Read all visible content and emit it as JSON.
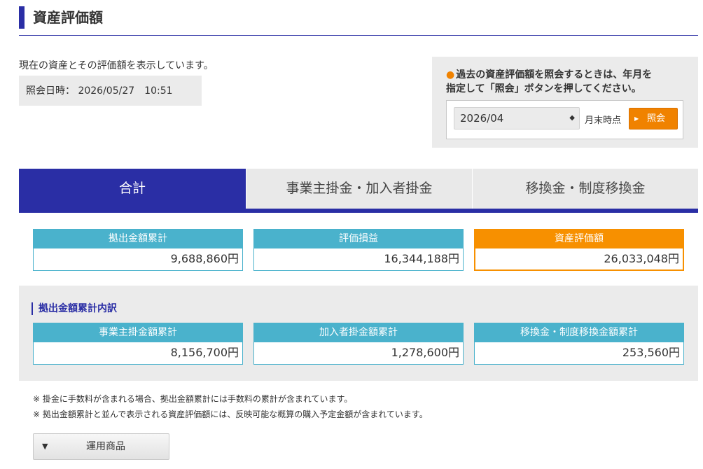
{
  "header": {
    "title": "資産評価額"
  },
  "intro": {
    "description": "現在の資産とその評価額を表示しています。",
    "datetime_label": "照会日時：",
    "date": "2026/05/27",
    "time": "10:51"
  },
  "query": {
    "note_line1": "過去の資産評価額を照会するときは、年月を",
    "note_line2": "指定して「照会」ボタンを押してください。",
    "selected_month": "2026/04",
    "suffix": "月末時点",
    "button_label": "照会",
    "accent_color": "#f08200"
  },
  "tabs": [
    {
      "label": "合計",
      "active": true
    },
    {
      "label": "事業主掛金・加入者掛金",
      "active": false
    },
    {
      "label": "移換金・制度移換金",
      "active": false
    }
  ],
  "summary": [
    {
      "label": "拠出金額累計",
      "value": "9,688,860円"
    },
    {
      "label": "評価損益",
      "value": "16,344,188円"
    },
    {
      "label": "資産評価額",
      "value": "26,033,048円"
    }
  ],
  "breakdown": {
    "title": "拠出金額累計内訳",
    "items": [
      {
        "label": "事業主掛金額累計",
        "value": "8,156,700円"
      },
      {
        "label": "加入者掛金額累計",
        "value": "1,278,600円"
      },
      {
        "label": "移換金・制度移換金額累計",
        "value": "253,560円"
      }
    ]
  },
  "notes": [
    "※ 掛金に手数料が含まれる場合、拠出金額累計には手数料の累計が含まれています。",
    "※ 拠出金額累計と並んで表示される資産評価額には、反映可能な概算の購入予定金額が含まれています。"
  ],
  "accordion": {
    "label": "運用商品"
  },
  "colors": {
    "primary": "#2a2ea5",
    "card_header": "#4ab2cc",
    "highlight": "#f79000"
  }
}
